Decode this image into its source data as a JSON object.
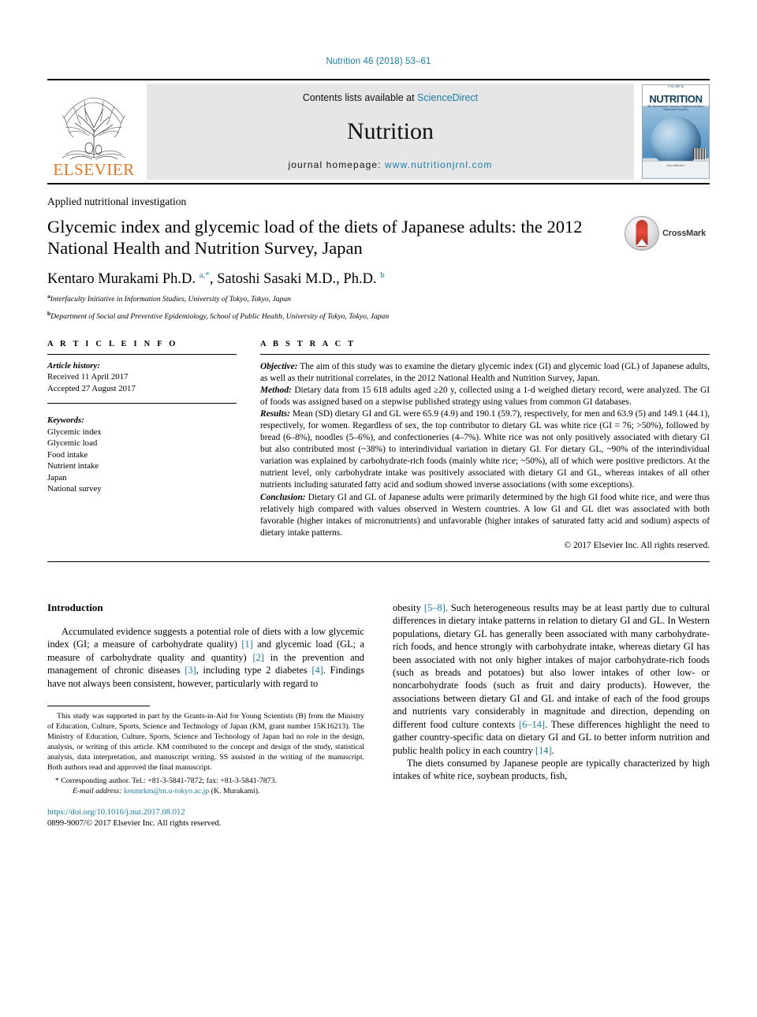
{
  "running_head": "Nutrition 46 (2018) 53–61",
  "masthead": {
    "publisher": "ELSEVIER",
    "contents_prefix": "Contents lists available at ",
    "contents_link": "ScienceDirect",
    "journal_name": "Nutrition",
    "homepage_prefix": "journal homepage: ",
    "homepage_url": "www.nutritionjrnl.com",
    "cover_title": "NUTRITION",
    "cover_subtitle": "The International Journal of Applied and Basic Nutritional Sciences",
    "cover_footer": "ISSN 0899-9007"
  },
  "article": {
    "section_kicker": "Applied nutritional investigation",
    "title": "Glycemic index and glycemic load of the diets of Japanese adults: the 2012 National Health and Nutrition Survey, Japan",
    "crossmark_label": "CrossMark",
    "authors_html": "Kentaro Murakami Ph.D. <sup>a,*</sup>, Satoshi Sasaki M.D., Ph.D. <sup>b</sup>",
    "affiliations": [
      {
        "marker": "a",
        "text": "Interfaculty Initiative in Information Studies, University of Tokyo, Tokyo, Japan"
      },
      {
        "marker": "b",
        "text": "Department of Social and Preventive Epidemiology, School of Public Health, University of Tokyo, Tokyo, Japan"
      }
    ]
  },
  "info": {
    "heading": "A R T I C L E   I N F O",
    "history_label": "Article history:",
    "received": "Received 11 April 2017",
    "accepted": "Accepted 27 August 2017",
    "keywords_label": "Keywords:",
    "keywords": [
      "Glycemic index",
      "Glycemic load",
      "Food intake",
      "Nutrient intake",
      "Japan",
      "National survey"
    ]
  },
  "abstract": {
    "heading": "A B S T R A C T",
    "objective_label": "Objective:",
    "objective_text": " The aim of this study was to examine the dietary glycemic index (GI) and glycemic load (GL) of Japanese adults, as well as their nutritional correlates, in the 2012 National Health and Nutrition Survey, Japan.",
    "method_label": "Method:",
    "method_text": " Dietary data from 15 618 adults aged ≥20 y, collected using a 1-d weighed dietary record, were analyzed. The GI of foods was assigned based on a stepwise published strategy using values from common GI databases.",
    "results_label": "Results:",
    "results_text": " Mean (SD) dietary GI and GL were 65.9 (4.9) and 190.1 (59.7), respectively, for men and 63.9 (5) and 149.1 (44.1), respectively, for women. Regardless of sex, the top contributor to dietary GL was white rice (GI = 76; >50%), followed by bread (6–8%), noodles (5–6%), and confectioneries (4–7%). White rice was not only positively associated with dietary GI but also contributed most (~38%) to interindividual variation in dietary GI. For dietary GL, ~90% of the interindividual variation was explained by carbohydrate-rich foods (mainly white rice; ~50%), all of which were positive predictors. At the nutrient level, only carbohydrate intake was positively associated with dietary GI and GL, whereas intakes of all other nutrients including saturated fatty acid and sodium showed inverse associations (with some exceptions).",
    "conclusion_label": "Conclusion:",
    "conclusion_text": " Dietary GI and GL of Japanese adults were primarily determined by the high GI food white rice, and were thus relatively high compared with values observed in Western countries. A low GI and GL diet was associated with both favorable (higher intakes of micronutrients) and unfavorable (higher intakes of saturated fatty acid and sodium) aspects of dietary intake patterns.",
    "copyright": "© 2017 Elsevier Inc. All rights reserved."
  },
  "introduction": {
    "heading": "Introduction",
    "left_paragraph_html": "Accumulated evidence suggests a potential role of diets with a low glycemic index (GI; a measure of carbohydrate quality) <span class=\"cit\">[1]</span> and glycemic load (GL; a measure of carbohydrate quality and quantity) <span class=\"cit\">[2]</span> in the prevention and management of chronic diseases <span class=\"cit\">[3]</span>, including type 2 diabetes <span class=\"cit\">[4]</span>. Findings have not always been consistent, however, particularly with regard to",
    "right_paragraph_1_html": "obesity <span class=\"cit\">[5–8]</span>. Such heterogeneous results may be at least partly due to cultural differences in dietary intake patterns in relation to dietary GI and GL. In Western populations, dietary GL has generally been associated with many carbohydrate-rich foods, and hence strongly with carbohydrate intake, whereas dietary GI has been associated with not only higher intakes of major carbohydrate-rich foods (such as breads and potatoes) but also lower intakes of other low- or noncarbohydrate foods (such as fruit and dairy products). However, the associations between dietary GI and GL and intake of each of the food groups and nutrients vary considerably in magnitude and direction, depending on different food culture contexts <span class=\"cit\">[6–14]</span>. These differences highlight the need to gather country-specific data on dietary GI and GL to better inform nutrition and public health policy in each country <span class=\"cit\">[14]</span>.",
    "right_paragraph_2_html": "The diets consumed by Japanese people are typically characterized by high intakes of white rice, soybean products, fish,"
  },
  "footnotes": {
    "funding_text": "This study was supported in part by the Grants-in-Aid for Young Scientists (B) from the Ministry of Education, Culture, Sports, Science and Technology of Japan (KM, grant number 15K16213). The Ministry of Education, Culture, Sports, Science and Technology of Japan had no role in the design, analysis, or writing of this article. KM contributed to the concept and design of the study, statistical analysis, data interpretation, and manuscript writing. SS assisted in the writing of the manuscript. Both authors read and approved the final manuscript.",
    "corresponding_text": "* Corresponding author. Tel.: +81-3-5841-7872; fax: +81-3-5841-7873.",
    "email_label": "E-mail address:",
    "email_link": "kenmrkm@m.u-tokyo.ac.jp",
    "email_suffix": " (K. Murakami)."
  },
  "footer": {
    "doi_url": "https://doi.org/10.1016/j.nut.2017.08.012",
    "copyright": "0899-9007/© 2017 Elsevier Inc. All rights reserved."
  },
  "colors": {
    "link_blue": "#1a7ca8",
    "elsevier_orange": "#e87722",
    "banner_gray": "#e6e6e6"
  }
}
